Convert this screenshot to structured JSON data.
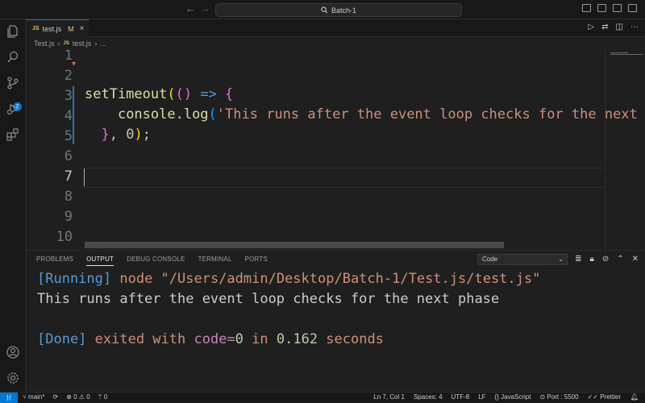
{
  "titlebar": {
    "search_text": "Batch-1",
    "back": "←",
    "forward": "→"
  },
  "activity": {
    "scm_badge": "2"
  },
  "tab": {
    "icon": "JS",
    "label": "test.js",
    "modified": "M",
    "close": "×"
  },
  "breadcrumb": {
    "folder": "Test.js",
    "sep1": "›",
    "icon": "JS",
    "file": "test.js",
    "sep2": "›",
    "more": "..."
  },
  "editor": {
    "line_numbers": [
      "1",
      "2",
      "3",
      "4",
      "5",
      "6",
      "7",
      "8",
      "9",
      "10"
    ],
    "active_line": "7",
    "code": {
      "l3_fn": "setTimeout",
      "l3_p1": "(",
      "l3_p2": "()",
      "l3_arrow": " => ",
      "l3_brace": "{",
      "l4_indent": "    ",
      "l4_obj": "console.log",
      "l4_paren": "(",
      "l4_str": "'This runs after the event loop checks for the next phase'",
      "l5_indent": "  ",
      "l5_brace": "}",
      "l5_comma": ", ",
      "l5_num": "0",
      "l5_paren": ")",
      "l5_semi": ";"
    }
  },
  "panel": {
    "tabs": [
      "PROBLEMS",
      "OUTPUT",
      "DEBUG CONSOLE",
      "TERMINAL",
      "PORTS"
    ],
    "active_tab": "OUTPUT",
    "select_value": "Code",
    "output": {
      "running_tag": "[Running]",
      "running_cmd": " node ",
      "running_path": "\"/Users/admin/Desktop/Batch-1/Test.js/test.js\"",
      "line2": "This runs after the event loop checks for the next phase",
      "done_tag": "[Done]",
      "done_text1": " exited with ",
      "done_code": "code=",
      "done_zero": "0",
      "done_in": " in ",
      "done_secs": "0.162",
      "done_text2": " seconds"
    }
  },
  "status": {
    "branch": "main*",
    "errors": "0",
    "warnings": "0",
    "ports_count": "0",
    "position": "Ln 7, Col 1",
    "spaces": "Spaces: 4",
    "encoding": "UTF-8",
    "eol": "LF",
    "language": "JavaScript",
    "port": "Port : 5500",
    "formatter": "Prettier"
  }
}
